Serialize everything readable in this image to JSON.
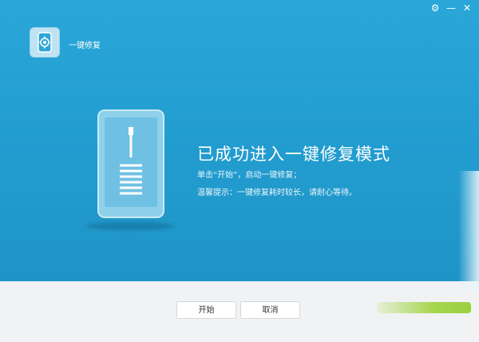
{
  "window": {
    "controls": {
      "settings_glyph": "⚙",
      "minimize_glyph": "—",
      "close_glyph": "✕"
    }
  },
  "header": {
    "app_icon": "gear-phone-icon",
    "title": "一键修复"
  },
  "main": {
    "illustration": "phone-usb-icon",
    "headline": "已成功进入一键修复模式",
    "instruction": "单击“开始”，启动一键修复；",
    "tip": "温馨提示：一键修复耗时较长，请耐心等待。"
  },
  "footer": {
    "start_label": "开始",
    "cancel_label": "取消"
  },
  "colors": {
    "panel_blue": "#229ccf",
    "footer_gray": "#f0f2f3",
    "accent_green": "#a6d64e"
  }
}
